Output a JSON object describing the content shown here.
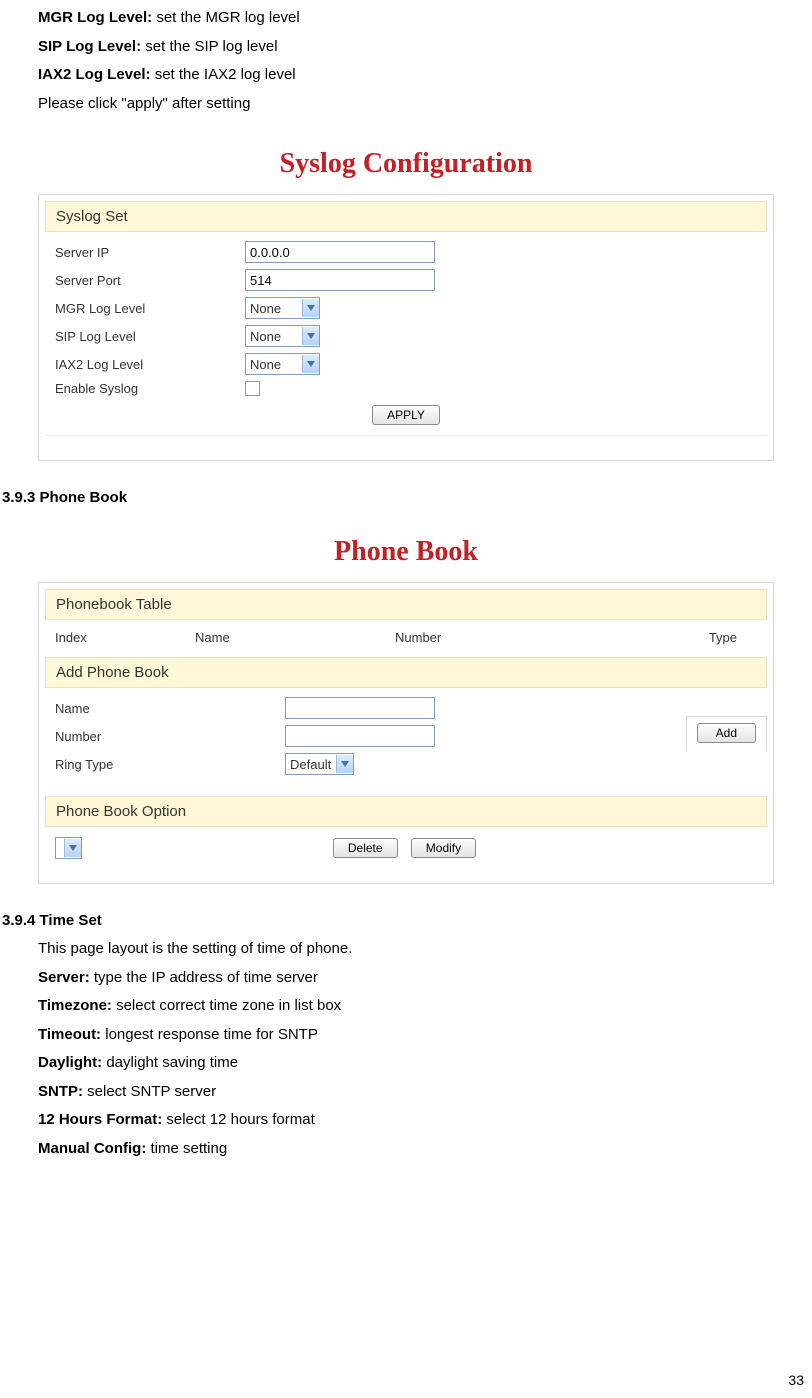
{
  "intro": {
    "mgr_label": "MGR Log Level:",
    "mgr_text": " set the MGR log level",
    "sip_label": "SIP Log Level:",
    "sip_text": " set the SIP log level",
    "iax2_label": "IAX2 Log Level:",
    "iax2_text": " set the IAX2 log level",
    "apply_note": "Please click \"apply\" after setting"
  },
  "syslog": {
    "title": "Syslog Configuration",
    "band": "Syslog Set",
    "rows": {
      "server_ip_label": "Server IP",
      "server_ip_value": "0.0.0.0",
      "server_port_label": "Server Port",
      "server_port_value": "514",
      "mgr_label": "MGR Log Level",
      "mgr_value": "None",
      "sip_label": "SIP Log Level",
      "sip_value": "None",
      "iax2_label": "IAX2 Log Level",
      "iax2_value": "None",
      "enable_label": "Enable Syslog"
    },
    "apply_btn": "APPLY"
  },
  "section393": "3.9.3 Phone Book",
  "phonebook": {
    "title": "Phone Book",
    "band_table": "Phonebook Table",
    "cols": {
      "index": "Index",
      "name": "Name",
      "number": "Number",
      "type": "Type"
    },
    "band_add": "Add Phone Book",
    "rows": {
      "name_label": "Name",
      "number_label": "Number",
      "ring_label": "Ring Type",
      "ring_value": "Default"
    },
    "add_btn": "Add",
    "band_option": "Phone Book Option",
    "delete_btn": "Delete",
    "modify_btn": "Modify"
  },
  "section394": {
    "heading": "3.9.4 Time Set",
    "intro": "This page layout is the setting of time of phone.",
    "server_label": "Server:",
    "server_text": " type the IP address of time server",
    "timezone_label": "Timezone:",
    "timezone_text": " select correct time zone in list box",
    "timeout_label": "Timeout:",
    "timeout_text": " longest response time for SNTP",
    "daylight_label": "Daylight:",
    "daylight_text": " daylight saving time",
    "sntp_label": "SNTP:",
    "sntp_text": " select SNTP server",
    "hours_label": "12 Hours Format:",
    "hours_text": " select 12 hours format",
    "manual_label": "Manual Config:",
    "manual_text": " time setting"
  },
  "page_number": "33"
}
